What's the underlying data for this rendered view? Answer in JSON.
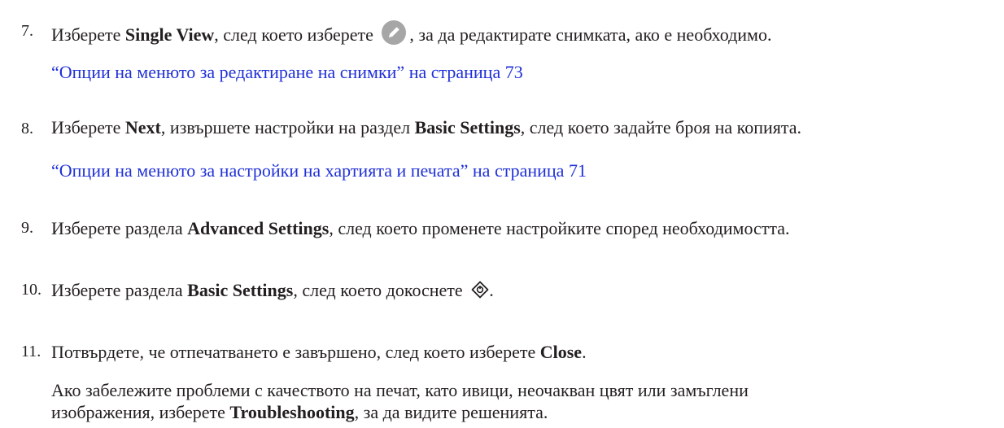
{
  "steps": [
    {
      "number": "7.",
      "parts": {
        "t1": "Изберете ",
        "b1": "Single View",
        "t2": ", след което изберете ",
        "t3": ", за да редактирате снимката, ако е необходимо."
      },
      "icon": "edit-pencil-icon",
      "link": "“Опции на менюто за редактиране на снимки” на страница 73"
    },
    {
      "number": "8.",
      "parts": {
        "t1": "Изберете ",
        "b1": "Next",
        "t2": ", извършете настройки на раздел ",
        "b2": "Basic Settings",
        "t3": ", след което задайте броя на копията."
      },
      "link": "“Опции на менюто за настройки на хартията и печата” на страница 71"
    },
    {
      "number": "9.",
      "parts": {
        "t1": "Изберете раздела ",
        "b1": "Advanced Settings",
        "t2": ", след което променете настройките според необходимостта."
      }
    },
    {
      "number": "10.",
      "parts": {
        "t1": "Изберете раздела ",
        "b1": "Basic Settings",
        "t2": ", след което докоснете ",
        "t3": "."
      },
      "icon": "start-diamond-icon"
    },
    {
      "number": "11.",
      "parts": {
        "t1": "Потвърдете, че отпечатването е завършено, след което изберете ",
        "b1": "Close",
        "t2": "."
      },
      "note": {
        "line1": "Ако забележите проблеми с качеството на печат, като ивици, неочакван цвят или замъглени",
        "line2_t1": "изображения, изберете ",
        "line2_b1": "Troubleshooting",
        "line2_t2": ", за да видите решенията."
      }
    }
  ],
  "colors": {
    "text": "#231f20",
    "link": "#1f30d8",
    "icon_fill": "#a6a6a6"
  }
}
